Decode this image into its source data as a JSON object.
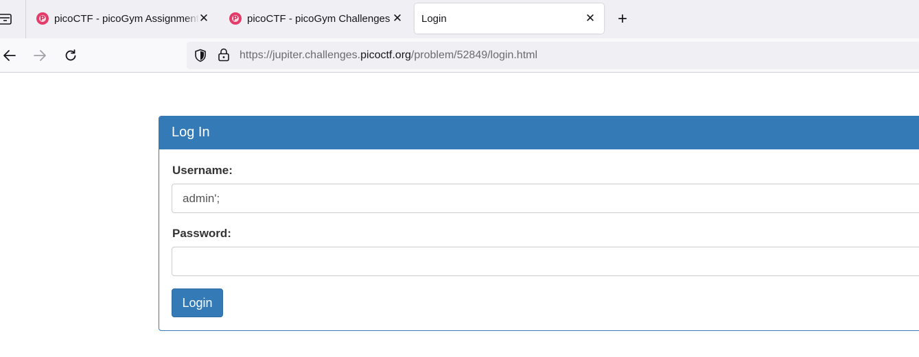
{
  "tabs": [
    {
      "favicon": "picoctf-icon",
      "label": "picoCTF - picoGym Assignments",
      "close": "✕"
    },
    {
      "favicon": "picoctf-icon",
      "label": "picoCTF - picoGym Challenges",
      "close": "✕"
    },
    {
      "label": "Login",
      "close": "✕",
      "active": true
    }
  ],
  "new_tab_label": "+",
  "address_bar": {
    "url_prefix": "https://jupiter.challenges.",
    "url_host": "picoctf.org",
    "url_path": "/problem/52849/login.html"
  },
  "login_panel": {
    "title": "Log In",
    "username_label": "Username:",
    "username_value": "admin';",
    "password_label": "Password:",
    "password_value": "",
    "submit_label": "Login"
  },
  "colors": {
    "primary": "#337ab7",
    "tabstrip": "#f0f0f4",
    "favicon": "#e33b6a"
  }
}
